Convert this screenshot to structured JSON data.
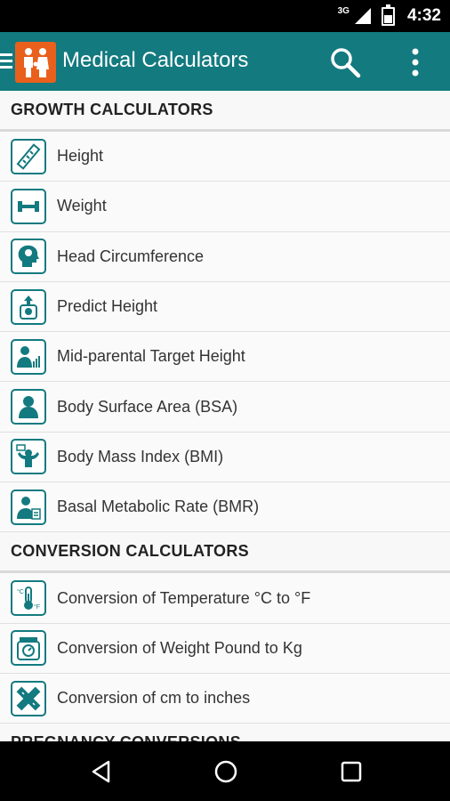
{
  "status_bar": {
    "network": "3G",
    "time": "4:32"
  },
  "app_bar": {
    "title": "Medical Calculators"
  },
  "sections": [
    {
      "title": "GROWTH CALCULATORS",
      "items": [
        {
          "label": "Height",
          "icon": "ruler-icon"
        },
        {
          "label": "Weight",
          "icon": "dumbbell-icon"
        },
        {
          "label": "Head Circumference",
          "icon": "head-brain-icon"
        },
        {
          "label": "Predict Height",
          "icon": "predict-height-icon"
        },
        {
          "label": "Mid-parental Target Height",
          "icon": "person-chart-icon"
        },
        {
          "label": "Body Surface Area (BSA)",
          "icon": "person-icon"
        },
        {
          "label": "Body Mass Index (BMI)",
          "icon": "bodybuilder-icon"
        },
        {
          "label": "Basal Metabolic Rate (BMR)",
          "icon": "person-calculator-icon"
        }
      ]
    },
    {
      "title": "CONVERSION CALCULATORS",
      "items": [
        {
          "label": "Conversion of Temperature °C to °F",
          "icon": "thermometer-icon"
        },
        {
          "label": "Conversion of Weight Pound to Kg",
          "icon": "scale-icon"
        },
        {
          "label": "Conversion of cm to inches",
          "icon": "measuring-tape-icon"
        }
      ]
    },
    {
      "title": "PREGNANCY CONVERSIONS",
      "items": []
    }
  ],
  "colors": {
    "primary": "#137a7f",
    "logo": "#e8601c",
    "status_bar": "#000000"
  }
}
